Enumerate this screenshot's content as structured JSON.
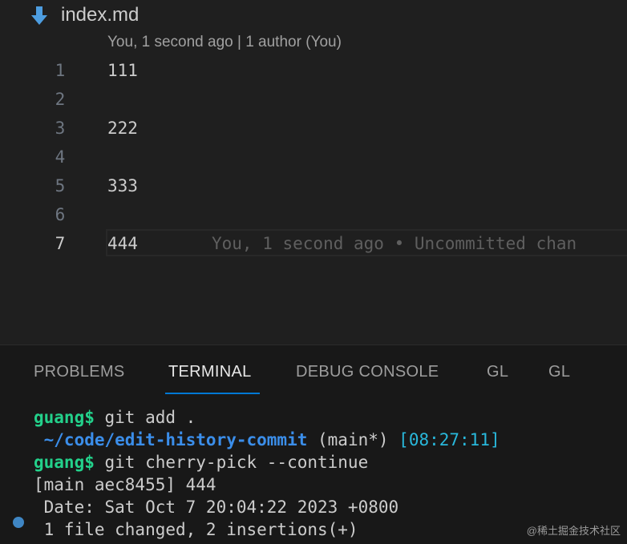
{
  "editor": {
    "tab_title": "index.md",
    "codelens": "You, 1 second ago | 1 author (You)",
    "lines": [
      {
        "number": "1",
        "text": "111"
      },
      {
        "number": "2",
        "text": ""
      },
      {
        "number": "3",
        "text": "222"
      },
      {
        "number": "4",
        "text": ""
      },
      {
        "number": "5",
        "text": "333"
      },
      {
        "number": "6",
        "text": ""
      },
      {
        "number": "7",
        "text": "444"
      }
    ],
    "blame": "You, 1 second ago • Uncommitted chan"
  },
  "panel": {
    "tabs": [
      "PROBLEMS",
      "TERMINAL",
      "DEBUG CONSOLE",
      "GL",
      "GL"
    ],
    "active_tab": "TERMINAL"
  },
  "terminal": {
    "prompt1": "guang$",
    "cmd1": " git add .",
    "path": " ~/code/edit-history-commit",
    "branch": " (main*) ",
    "time": "[08:27:11]",
    "prompt2": "guang$",
    "cmd2": " git cherry-pick --continue",
    "out1": "[main aec8455] 444",
    "out2": " Date: Sat Oct 7 20:04:22 2023 +0800",
    "out3": " 1 file changed, 2 insertions(+)"
  },
  "watermark": "@稀土掘金技术社区",
  "colors": {
    "background": "#1f1f1f",
    "panel_background": "#181818",
    "accent": "#0078d4",
    "prompt_green": "#23d18b",
    "path_blue": "#3b8eea",
    "time_cyan": "#29b8db"
  }
}
